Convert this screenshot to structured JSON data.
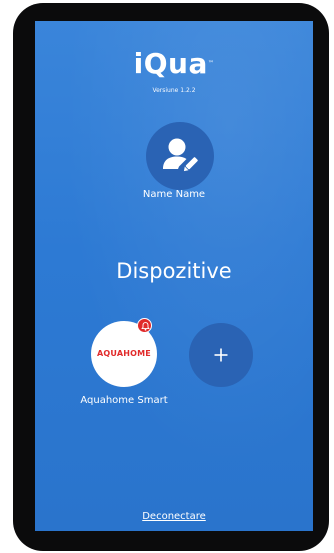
{
  "app": {
    "logo_text": "iQua",
    "version": "Versiune 1.2.2"
  },
  "user": {
    "name": "Name Name",
    "avatar_icon": "user-edit-icon"
  },
  "section": {
    "title": "Dispozitive"
  },
  "devices": [
    {
      "brand": "AQUAHOME",
      "label": "Aquahome Smart",
      "has_alert": true,
      "alert_icon": "bell-icon"
    }
  ],
  "actions": {
    "add_icon": "plus-icon",
    "logout_label": "Deconectare"
  },
  "colors": {
    "background": "#2d7ad4",
    "circle_dark": "#2a63b4",
    "brand_red": "#e12a2a",
    "frame": "#0b0b0c",
    "text": "#ffffff"
  }
}
